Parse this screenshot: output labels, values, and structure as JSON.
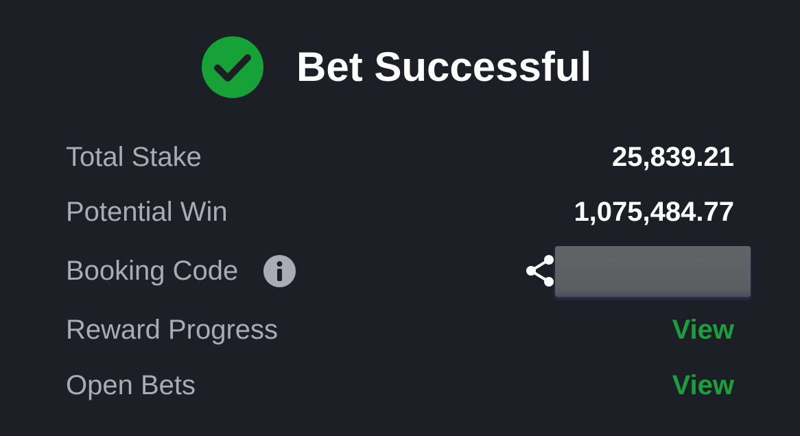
{
  "header": {
    "icon": "check-circle-icon",
    "title": "Bet Successful"
  },
  "rows": {
    "total_stake": {
      "label": "Total Stake",
      "value": "25,839.21"
    },
    "potential_win": {
      "label": "Potential Win",
      "value": "1,075,484.77"
    },
    "booking_code": {
      "label": "Booking Code",
      "info_icon": "info-icon",
      "share_icon": "share-icon"
    },
    "reward_progress": {
      "label": "Reward Progress",
      "link": "View"
    },
    "open_bets": {
      "label": "Open Bets",
      "link": "View"
    }
  },
  "colors": {
    "background": "#1d1f26",
    "success_green": "#17a238",
    "link_green": "#1d9e3c",
    "label_gray": "#a9acb5",
    "value_white": "#ffffff"
  }
}
